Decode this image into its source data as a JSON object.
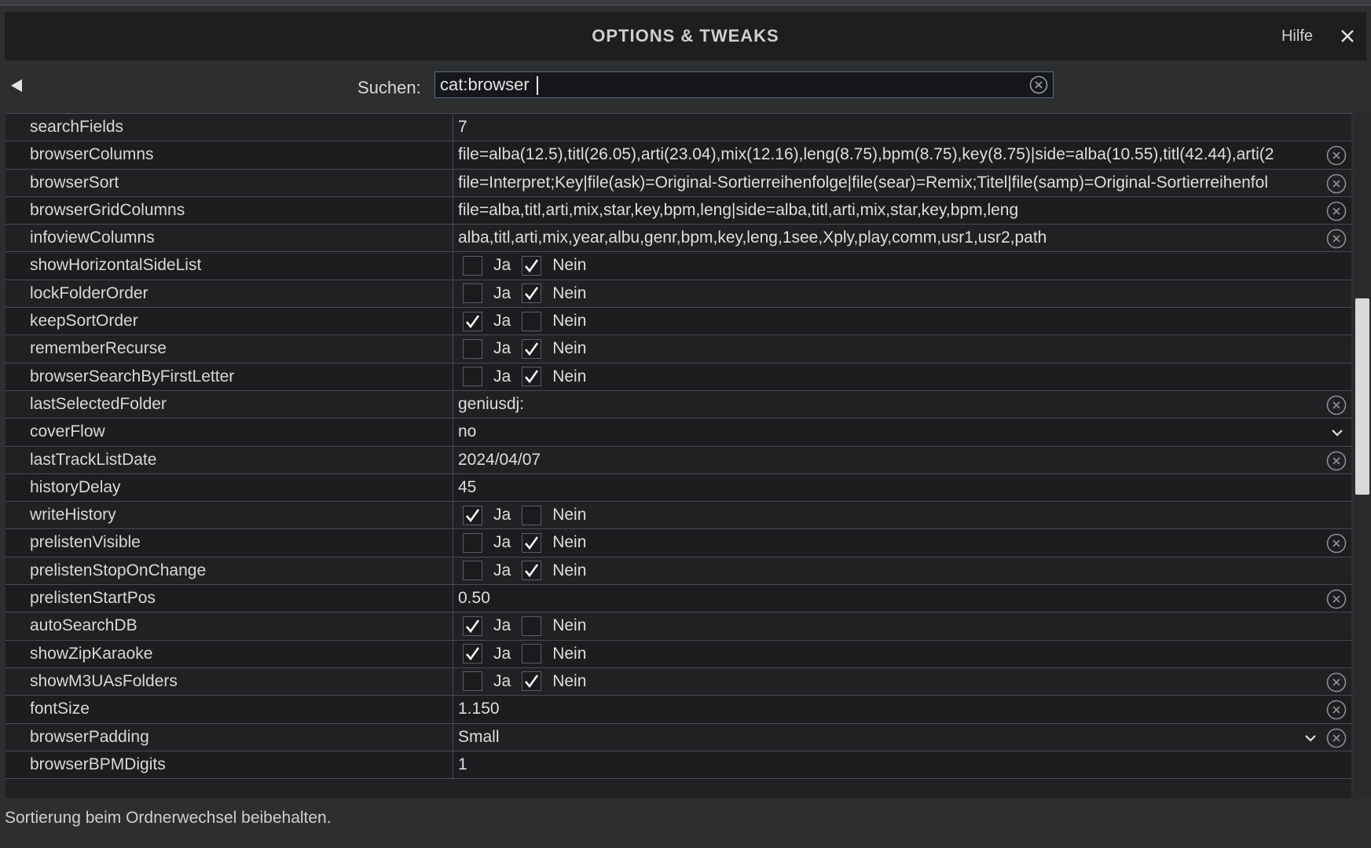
{
  "window": {
    "title": "OPTIONS & TWEAKS",
    "help_label": "Hilfe"
  },
  "search": {
    "label": "Suchen:",
    "value": "cat:browser"
  },
  "checkbox_labels": {
    "yes": "Ja",
    "no": "Nein"
  },
  "rows": [
    {
      "name": "searchFields",
      "type": "text",
      "value": "7",
      "clear": false
    },
    {
      "name": "browserColumns",
      "type": "text",
      "value": "file=alba(12.5),titl(26.05),arti(23.04),mix(12.16),leng(8.75),bpm(8.75),key(8.75)|side=alba(10.55),titl(42.44),arti(2",
      "clear": true
    },
    {
      "name": "browserSort",
      "type": "text",
      "value": "file=Interpret;Key|file(ask)=Original-Sortierreihenfolge|file(sear)=Remix;Titel|file(samp)=Original-Sortierreihenfol",
      "clear": true
    },
    {
      "name": "browserGridColumns",
      "type": "text",
      "value": "file=alba,titl,arti,mix,star,key,bpm,leng|side=alba,titl,arti,mix,star,key,bpm,leng",
      "clear": true
    },
    {
      "name": "infoviewColumns",
      "type": "text",
      "value": "alba,titl,arti,mix,year,albu,genr,bpm,key,leng,1see,Xply,play,comm,usr1,usr2,path",
      "clear": true
    },
    {
      "name": "showHorizontalSideList",
      "type": "bool",
      "value": false,
      "clear": false
    },
    {
      "name": "lockFolderOrder",
      "type": "bool",
      "value": false,
      "clear": false
    },
    {
      "name": "keepSortOrder",
      "type": "bool",
      "value": true,
      "clear": false
    },
    {
      "name": "rememberRecurse",
      "type": "bool",
      "value": false,
      "clear": false
    },
    {
      "name": "browserSearchByFirstLetter",
      "type": "bool",
      "value": false,
      "clear": false
    },
    {
      "name": "lastSelectedFolder",
      "type": "text",
      "value": "geniusdj:",
      "clear": true
    },
    {
      "name": "coverFlow",
      "type": "select",
      "value": "no",
      "clear": false
    },
    {
      "name": "lastTrackListDate",
      "type": "text",
      "value": "2024/04/07",
      "clear": true
    },
    {
      "name": "historyDelay",
      "type": "text",
      "value": "45",
      "clear": false
    },
    {
      "name": "writeHistory",
      "type": "bool",
      "value": true,
      "clear": false
    },
    {
      "name": "prelistenVisible",
      "type": "bool",
      "value": false,
      "clear": true
    },
    {
      "name": "prelistenStopOnChange",
      "type": "bool",
      "value": false,
      "clear": false
    },
    {
      "name": "prelistenStartPos",
      "type": "text",
      "value": "0.50",
      "clear": true
    },
    {
      "name": "autoSearchDB",
      "type": "bool",
      "value": true,
      "clear": false
    },
    {
      "name": "showZipKaraoke",
      "type": "bool",
      "value": true,
      "clear": false
    },
    {
      "name": "showM3UAsFolders",
      "type": "bool",
      "value": false,
      "clear": true
    },
    {
      "name": "fontSize",
      "type": "text",
      "value": "1.150",
      "clear": true
    },
    {
      "name": "browserPadding",
      "type": "select",
      "value": "Small",
      "clear": true
    },
    {
      "name": "browserBPMDigits",
      "type": "text",
      "value": "1",
      "clear": false
    }
  ],
  "status_text": "Sortierung beim Ordnerwechsel beibehalten.",
  "icons": {
    "back": "triangle-left-icon",
    "close": "close-icon",
    "clear": "circle-x-icon",
    "dropdown": "chevron-down-icon",
    "check": "checkmark-icon"
  }
}
